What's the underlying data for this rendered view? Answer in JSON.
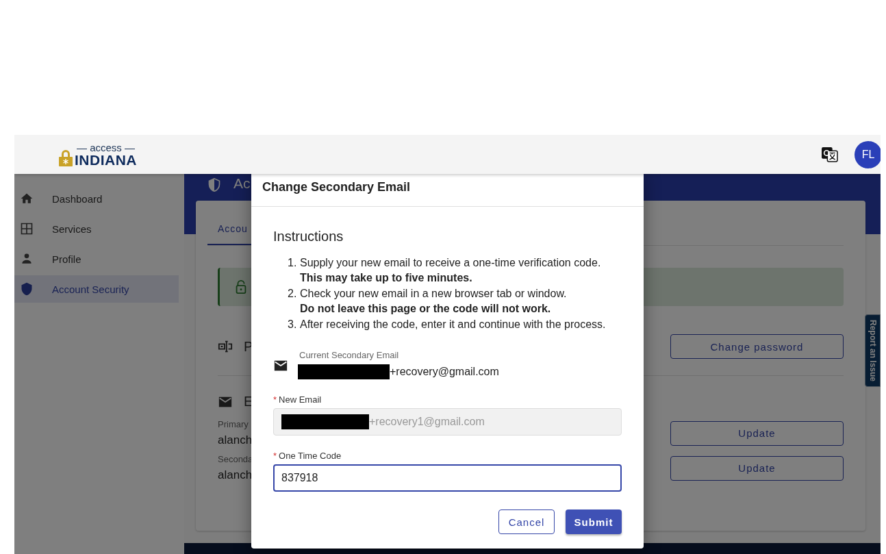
{
  "header": {
    "logo": {
      "top": "— access —",
      "bottom": "INDIANA"
    },
    "avatar": "FL"
  },
  "sidebar": {
    "items": [
      {
        "label": "Dashboard",
        "selected": false
      },
      {
        "label": "Services",
        "selected": false
      },
      {
        "label": "Profile",
        "selected": false
      },
      {
        "label": "Account Security",
        "selected": true
      }
    ]
  },
  "page": {
    "title": "Ac",
    "tabs": [
      {
        "label": "Accou",
        "selected": true
      }
    ],
    "password_section": {
      "heading": "P",
      "button": "Change password"
    },
    "email_section": {
      "heading": "E",
      "rows": [
        {
          "label": "Primary",
          "value": "alanch",
          "button": "Update"
        },
        {
          "label": "Seconda",
          "value": "alanch",
          "button": "Update"
        }
      ]
    }
  },
  "report_tab": "Report an Issue",
  "dialog": {
    "title": "Change Secondary Email",
    "heading": "Instructions",
    "steps": [
      {
        "number": "1.",
        "text": "Supply your new email to receive a one-time verification code.",
        "note": "This may take up to five minutes."
      },
      {
        "number": "2.",
        "text": "Check your new email in a new browser tab or window.",
        "note": "Do not leave this page or the code will not work."
      },
      {
        "number": "3.",
        "text": "After receiving the code, enter it and continue with the process."
      }
    ],
    "current": {
      "label": "Current Secondary Email",
      "value": "+recovery@gmail.com"
    },
    "fields": [
      {
        "label": "New Email",
        "required_mark": "*",
        "value": "+recovery1@gmail.com",
        "redacted": true,
        "disabled": true,
        "focused": false
      },
      {
        "label": "One Time Code",
        "required_mark": "*",
        "value": "837918",
        "redacted": false,
        "disabled": false,
        "focused": true
      }
    ],
    "buttons": [
      {
        "label": "Cancel",
        "kind": "secondary"
      },
      {
        "label": "Submit",
        "kind": "primary"
      }
    ]
  }
}
